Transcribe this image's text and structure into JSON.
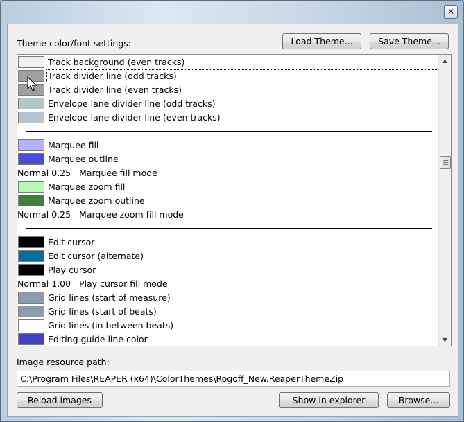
{
  "window": {
    "close_glyph": "✕"
  },
  "theme_label": "Theme color/font settings:",
  "buttons": {
    "load_theme": "Load Theme...",
    "save_theme": "Save Theme...",
    "reload_images": "Reload images",
    "show_in_explorer": "Show in explorer",
    "browse": "Browse..."
  },
  "list": {
    "rows": [
      {
        "kind": "color",
        "label": "Track background (even tracks)",
        "color": "#f4f0ec"
      },
      {
        "kind": "color",
        "label": "Track divider line (odd tracks)",
        "color": "#a0a0a0",
        "focused": true
      },
      {
        "kind": "color",
        "label": "Track divider line (even tracks)",
        "color": "#a0a0a0"
      },
      {
        "kind": "color",
        "label": "Envelope lane divider line (odd tracks)",
        "color": "#b6c4cc"
      },
      {
        "kind": "color",
        "label": "Envelope lane divider line (even tracks)",
        "color": "#b6c4cc"
      },
      {
        "kind": "divider"
      },
      {
        "kind": "color",
        "label": "Marquee fill",
        "color": "#b4b4fc"
      },
      {
        "kind": "color",
        "label": "Marquee outline",
        "color": "#4c4cdc"
      },
      {
        "kind": "mode",
        "value": "Normal 0.25",
        "label": "Marquee fill mode"
      },
      {
        "kind": "color",
        "label": "Marquee zoom fill",
        "color": "#b4fcb4"
      },
      {
        "kind": "color",
        "label": "Marquee zoom outline",
        "color": "#3c843c"
      },
      {
        "kind": "mode",
        "value": "Normal 0.25",
        "label": "Marquee zoom fill mode"
      },
      {
        "kind": "divider"
      },
      {
        "kind": "color",
        "label": "Edit cursor",
        "color": "#000000"
      },
      {
        "kind": "color",
        "label": "Edit cursor (alternate)",
        "color": "#0070a0"
      },
      {
        "kind": "color",
        "label": "Play cursor",
        "color": "#000000"
      },
      {
        "kind": "mode",
        "value": "Normal 1.00",
        "label": "Play cursor fill mode"
      },
      {
        "kind": "color",
        "label": "Grid lines (start of measure)",
        "color": "#8c9cac"
      },
      {
        "kind": "color",
        "label": "Grid lines (start of beats)",
        "color": "#8c9cac"
      },
      {
        "kind": "color",
        "label": "Grid lines (in between beats)",
        "color": "#ffffff"
      },
      {
        "kind": "color",
        "label": "Editing guide line color",
        "color": "#4040c8"
      }
    ]
  },
  "scrollbar": {
    "up_icon": "▲",
    "down_icon": "▼"
  },
  "image_path": {
    "label": "Image resource path:",
    "value": "C:\\Program Files\\REAPER (x64)\\ColorThemes\\Rogoff_New.ReaperThemeZip"
  }
}
